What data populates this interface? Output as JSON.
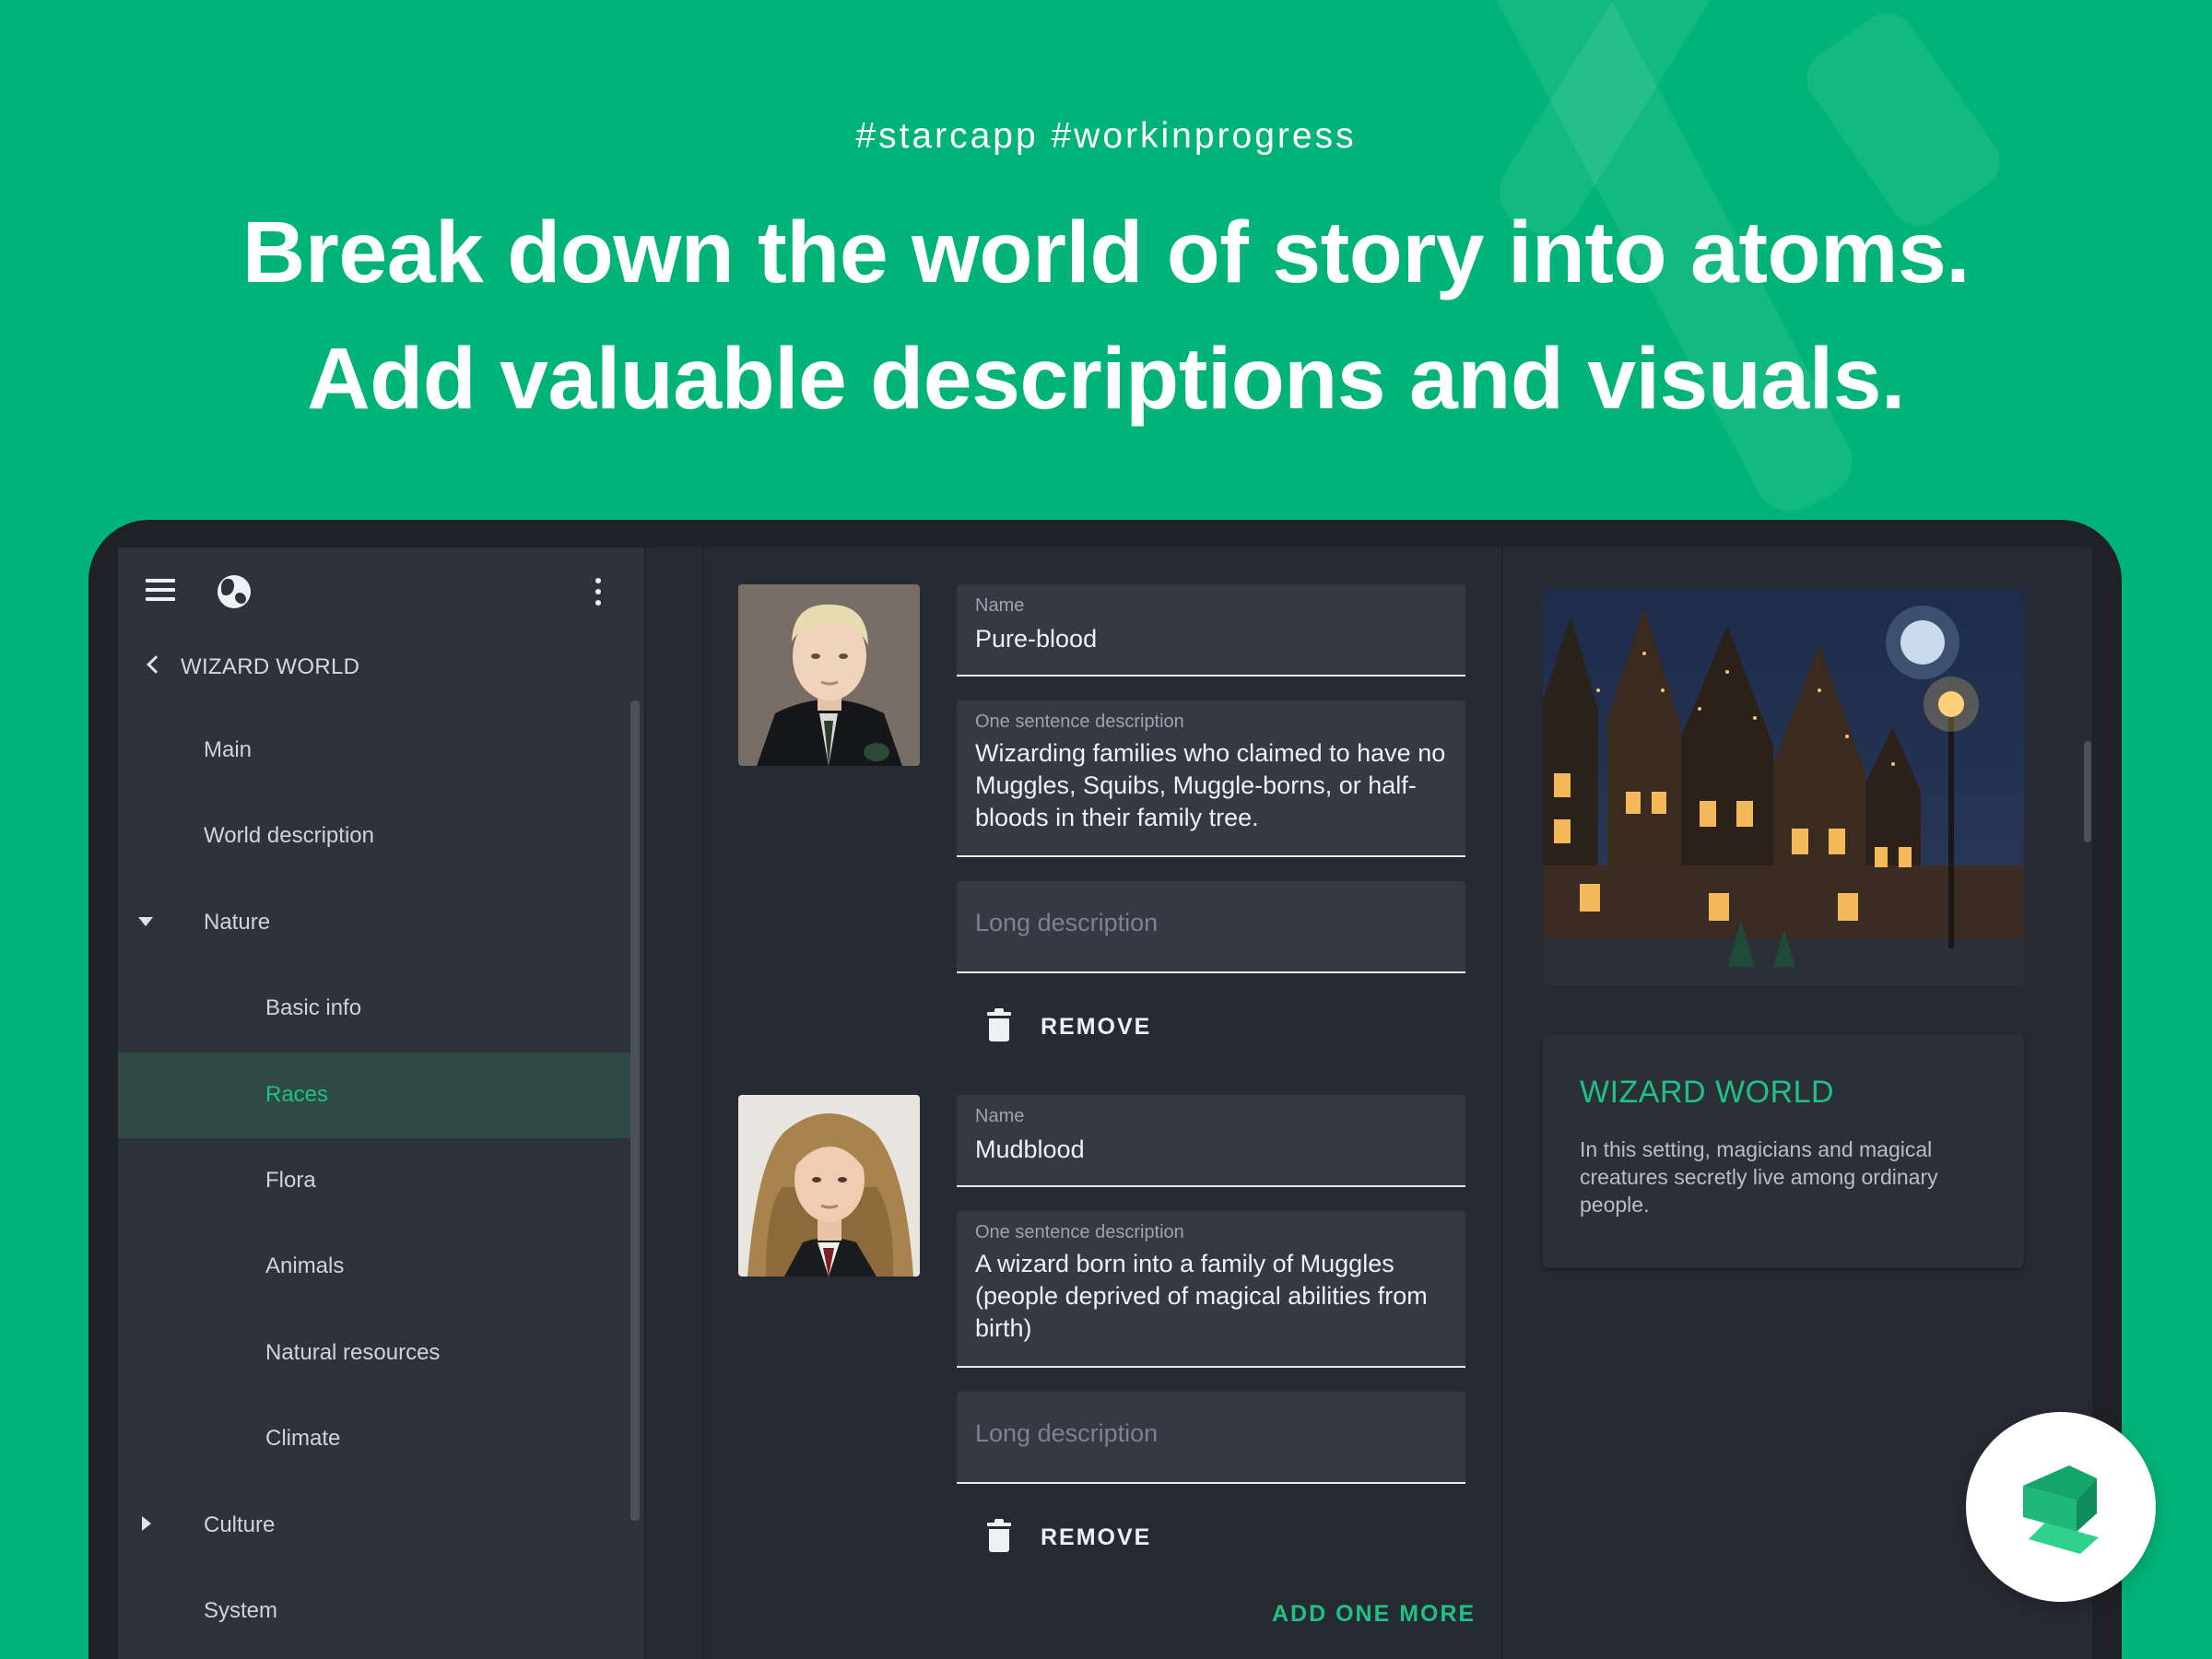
{
  "marketing": {
    "tags": "#starcapp  #workinprogress",
    "headline_line1": "Break down the world of story into atoms.",
    "headline_line2": "Add valuable descriptions and visuals."
  },
  "sidebar": {
    "back_label": "WIZARD WORLD",
    "items": [
      {
        "label": "Main"
      },
      {
        "label": "World description"
      },
      {
        "label": "Nature"
      },
      {
        "label": "Basic info"
      },
      {
        "label": "Races"
      },
      {
        "label": "Flora"
      },
      {
        "label": "Animals"
      },
      {
        "label": "Natural resources"
      },
      {
        "label": "Climate"
      },
      {
        "label": "Culture"
      },
      {
        "label": "System"
      }
    ],
    "active_item": "Races"
  },
  "races": [
    {
      "name_label": "Name",
      "name": "Pure-blood",
      "short_label": "One sentence description",
      "short_desc": "Wizarding families who claimed to have no Muggles, Squibs, Muggle-borns, or half-bloods in their family tree.",
      "long_placeholder": "Long description",
      "remove_label": "REMOVE"
    },
    {
      "name_label": "Name",
      "name": "Mudblood",
      "short_label": "One sentence description",
      "short_desc": "A wizard born into a family of Muggles (people deprived of magical abilities from birth)",
      "long_placeholder": "Long description",
      "remove_label": "REMOVE"
    }
  ],
  "add_more_label": "ADD ONE MORE",
  "world_card": {
    "title": "WIZARD WORLD",
    "description": "In this setting, magicians and magical creatures secretly live among ordinary people."
  },
  "colors": {
    "brand_green": "#00b378",
    "accent": "#1fc184",
    "panel_bg": "#252a33",
    "sidebar_bg": "#2d323b"
  }
}
